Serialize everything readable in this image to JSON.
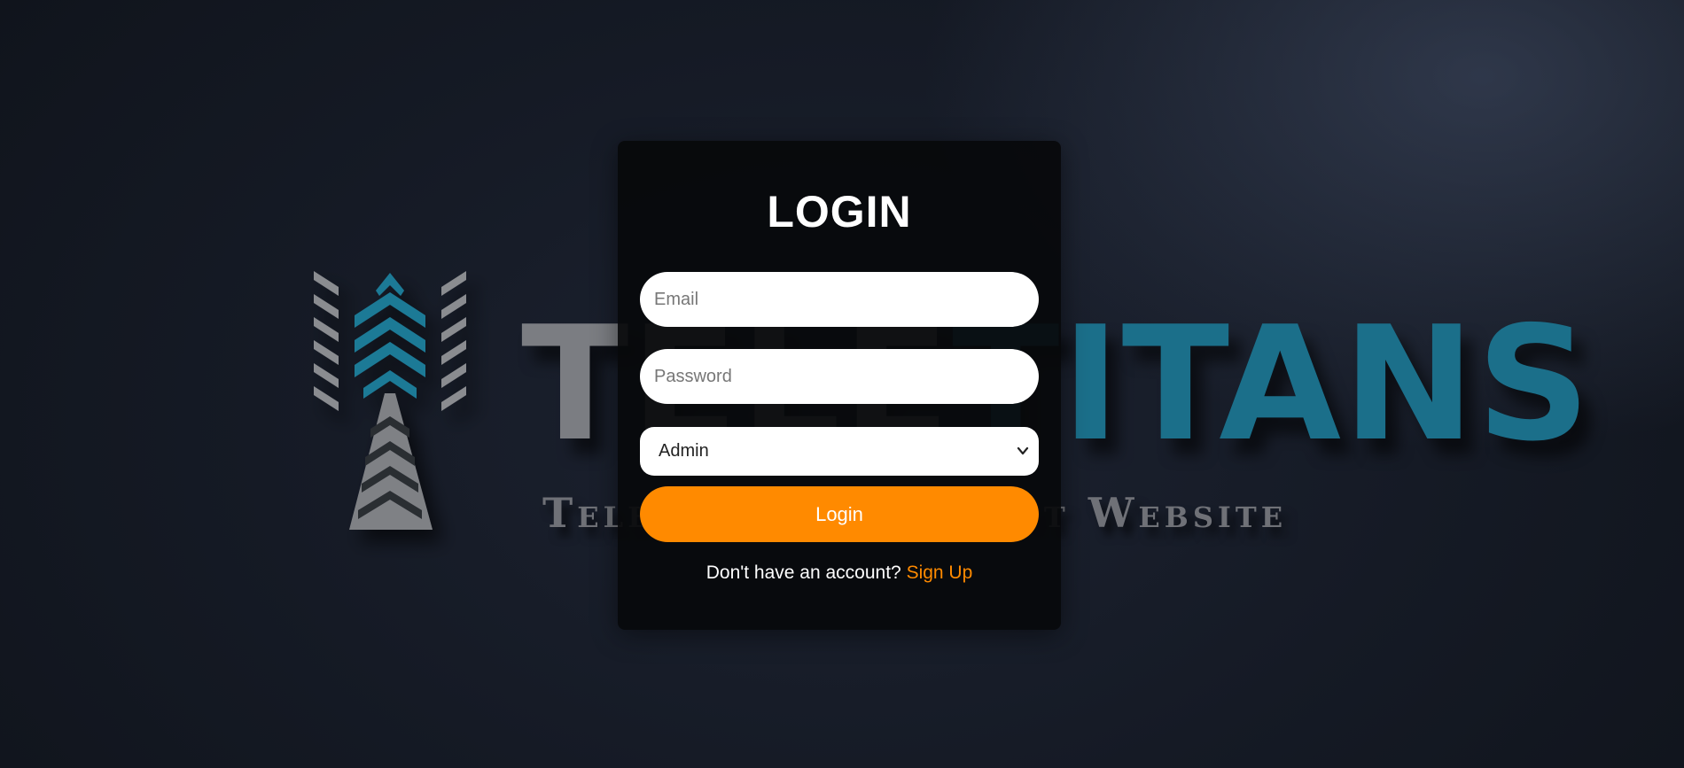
{
  "brand": {
    "word_part1": "TELE",
    "word_part2": "TITANS",
    "tagline": "Telecom Management Website",
    "colors": {
      "gray": "#7b7d82",
      "teal": "#1b6f8a"
    }
  },
  "login": {
    "title": "LOGIN",
    "email_placeholder": "Email",
    "password_placeholder": "Password",
    "role_selected": "Admin",
    "submit_label": "Login",
    "signup_prompt": "Don't have an account?",
    "signup_link": "Sign Up"
  },
  "colors": {
    "accent": "#ff8a00",
    "card": "#08090b",
    "background": "#151a25"
  }
}
